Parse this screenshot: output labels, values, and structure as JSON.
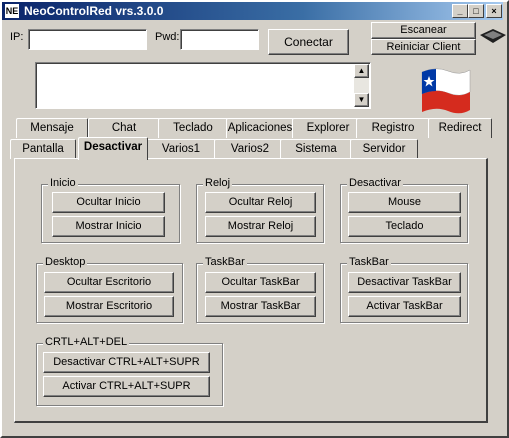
{
  "window": {
    "title": "NeoControlRed vrs.3.0.0",
    "app_icon": "NE"
  },
  "titlebar_buttons": {
    "minimize": "_",
    "maximize": "□",
    "close": "×"
  },
  "connection": {
    "ip_label": "IP:",
    "ip_value": "",
    "pwd_label": "Pwd:",
    "pwd_value": "",
    "connect_label": "Conectar"
  },
  "right_buttons": {
    "scan_label": "Escanear",
    "restart_label": "Reiniciar Client"
  },
  "scrollbar": {
    "up": "▲",
    "down": "▼"
  },
  "tabs_row1": [
    "Mensaje",
    "Chat",
    "Teclado",
    "Aplicaciones",
    "Explorer",
    "Registro",
    "Redirect"
  ],
  "tabs_row2": [
    "Pantalla",
    "Desactivar",
    "Varios1",
    "Varios2",
    "Sistema",
    "Servidor"
  ],
  "active_tab": "Desactivar",
  "groups": {
    "inicio": {
      "title": "Inicio",
      "hide": "Ocultar Inicio",
      "show": "Mostrar Inicio"
    },
    "reloj": {
      "title": "Reloj",
      "hide": "Ocultar Reloj",
      "show": "Mostrar Reloj"
    },
    "desactivar": {
      "title": "Desactivar",
      "mouse": "Mouse",
      "keyboard": "Teclado"
    },
    "desktop": {
      "title": "Desktop",
      "hide": "Ocultar Escritorio",
      "show": "Mostrar Escritorio"
    },
    "taskbar1": {
      "title": "TaskBar",
      "hide": "Ocultar TaskBar",
      "show": "Mostrar TaskBar"
    },
    "taskbar2": {
      "title": "TaskBar",
      "disable": "Desactivar TaskBar",
      "enable": "Activar TaskBar"
    },
    "cad": {
      "title": "CRTL+ALT+DEL",
      "disable": "Desactivar CTRL+ALT+SUPR",
      "enable": "Activar CTRL+ALT+SUPR"
    }
  },
  "colors": {
    "titlebar": "#0a246a",
    "face": "#d4d0c8",
    "flag_red": "#d52b1e",
    "flag_blue": "#0039a6"
  }
}
